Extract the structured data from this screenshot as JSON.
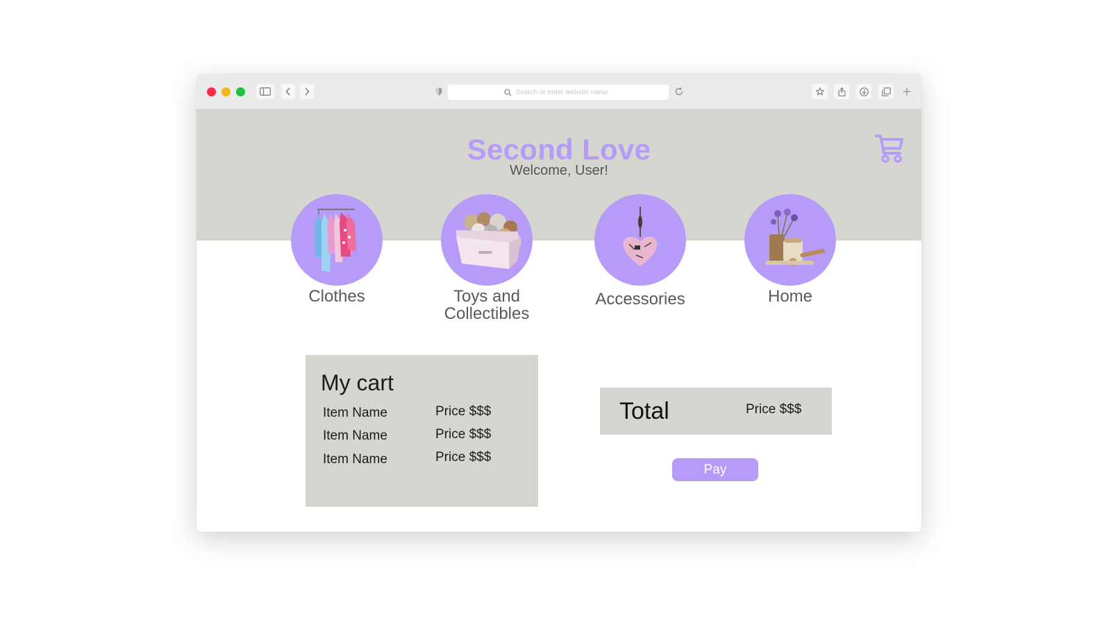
{
  "browser": {
    "address_placeholder": "Search or enter website name",
    "icons": [
      "sidebar-icon",
      "chevron-left-icon",
      "chevron-right-icon",
      "shield-icon",
      "search-icon",
      "reload-icon",
      "star-icon",
      "share-icon",
      "download-icon",
      "tabs-icon",
      "plus-icon"
    ]
  },
  "header": {
    "brand": "Second Love",
    "welcome": "Welcome, User!",
    "cart_icon": "shopping-cart-icon"
  },
  "categories": [
    {
      "label": "Clothes",
      "image": "clothes-rack-image"
    },
    {
      "label": "Toys and Collectibles",
      "image": "toy-box-image"
    },
    {
      "label": "Accessories",
      "image": "heart-ornament-image"
    },
    {
      "label": "Home",
      "image": "home-decor-image"
    }
  ],
  "cart": {
    "title": "My cart",
    "items": [
      {
        "name": "Item Name",
        "price": "Price $$$"
      },
      {
        "name": "Item Name",
        "price": "Price $$$"
      },
      {
        "name": "Item Name",
        "price": "Price $$$"
      }
    ]
  },
  "total": {
    "label": "Total",
    "price": "Price $$$"
  },
  "pay": {
    "label": "Pay"
  },
  "colors": {
    "accent": "#b69cf8",
    "panel": "#d6d6d1",
    "text_muted": "#595959"
  }
}
